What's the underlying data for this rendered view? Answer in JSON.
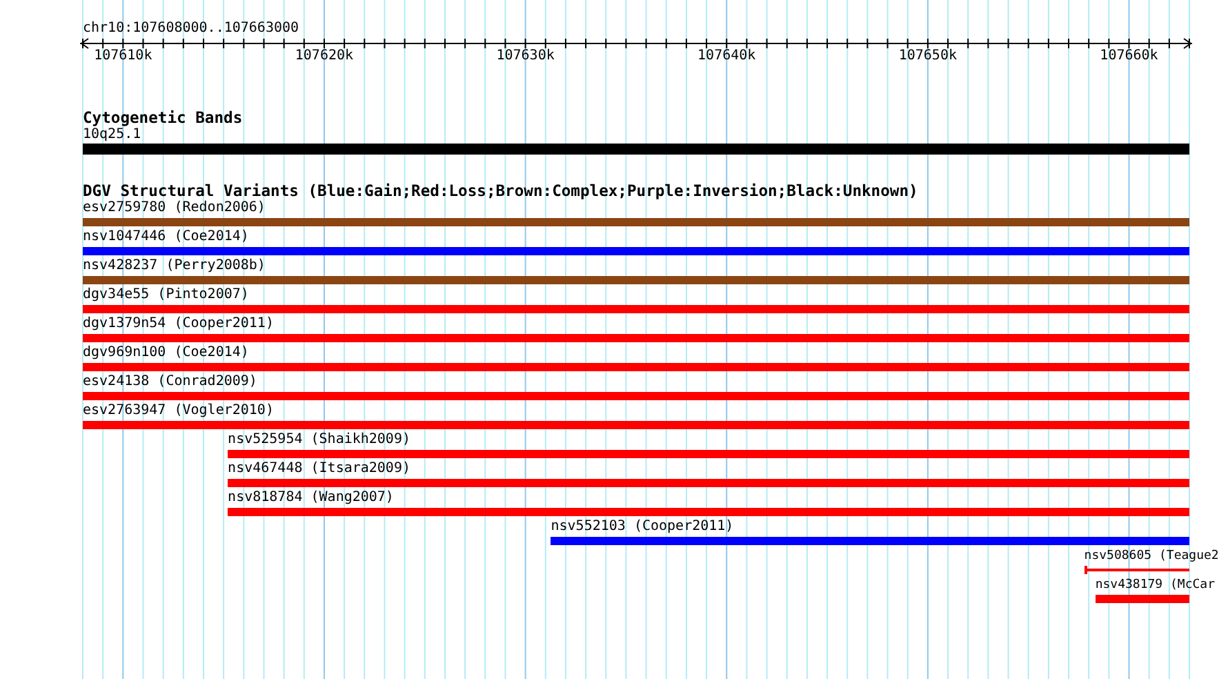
{
  "location": "chr10:107608000..107663000",
  "ruler": {
    "ticks": [
      "107610k",
      "107620k",
      "107630k",
      "107640k",
      "107650k",
      "107660k"
    ]
  },
  "tracks": [
    {
      "title": "Cytogenetic Bands",
      "kind": "bands",
      "features": [
        {
          "label": "10q25.1",
          "color": "#000000",
          "kind": "band"
        }
      ]
    },
    {
      "title": "DGV Structural Variants (Blue:Gain;Red:Loss;Brown:Complex;Purple:Inversion;Black:Unknown)",
      "kind": "variants",
      "features": [
        {
          "label": "esv2759780 (Redon2006)",
          "color": "#8b4513",
          "kind": "bar"
        },
        {
          "label": "nsv1047446 (Coe2014)",
          "color": "#0000ff",
          "kind": "bar"
        },
        {
          "label": "nsv428237 (Perry2008b)",
          "color": "#8b4513",
          "kind": "bar"
        },
        {
          "label": "dgv34e55 (Pinto2007)",
          "color": "#ff0000",
          "kind": "bar"
        },
        {
          "label": "dgv1379n54 (Cooper2011)",
          "color": "#ff0000",
          "kind": "bar"
        },
        {
          "label": "dgv969n100 (Coe2014)",
          "color": "#ff0000",
          "kind": "bar"
        },
        {
          "label": "esv24138 (Conrad2009)",
          "color": "#ff0000",
          "kind": "bar"
        },
        {
          "label": "esv2763947 (Vogler2010)",
          "color": "#ff0000",
          "kind": "bar"
        },
        {
          "label": "nsv525954 (Shaikh2009)",
          "color": "#ff0000",
          "kind": "bar"
        },
        {
          "label": "nsv467448 (Itsara2009)",
          "color": "#ff0000",
          "kind": "bar"
        },
        {
          "label": "nsv818784 (Wang2007)",
          "color": "#ff0000",
          "kind": "bar"
        },
        {
          "label": "nsv552103 (Cooper2011)",
          "color": "#0000ff",
          "kind": "bar"
        },
        {
          "label": "nsv508605 (Teague2",
          "color": "#ff0000",
          "kind": "thin"
        },
        {
          "label": "nsv438179 (McCar",
          "color": "#ff0000",
          "kind": "bar"
        }
      ]
    }
  ]
}
